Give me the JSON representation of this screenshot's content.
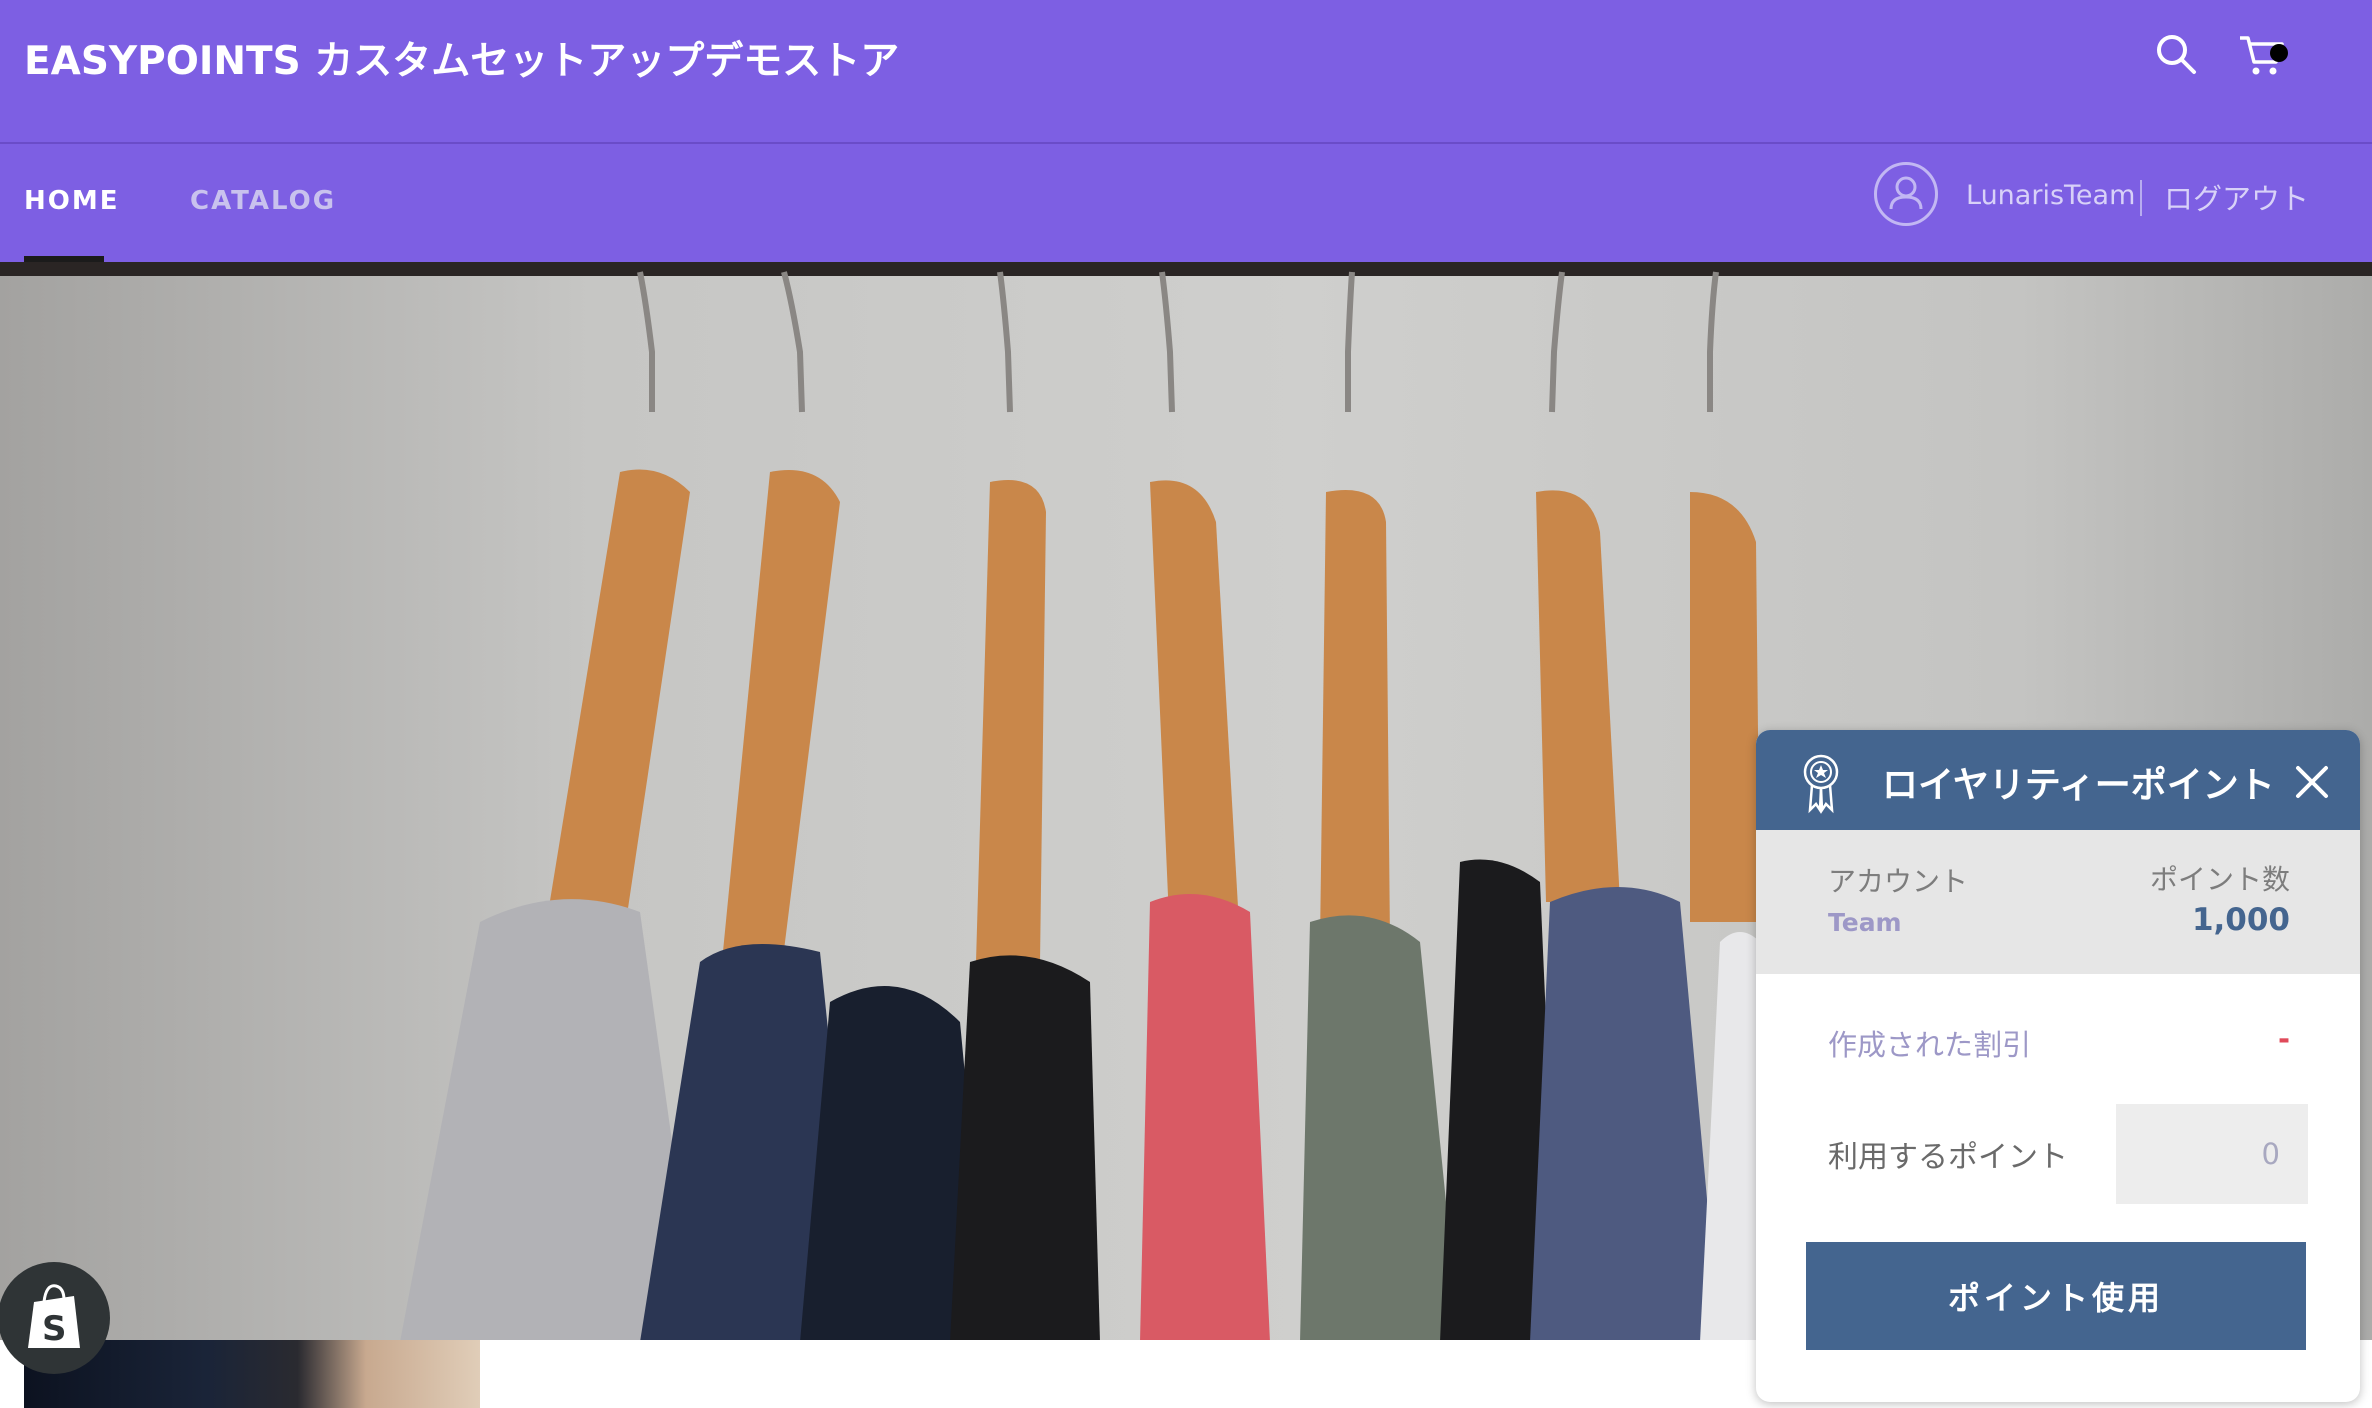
{
  "header": {
    "store_title": "EASYPOINTS カスタムセットアップデモストア",
    "search_icon": "search-icon",
    "cart_icon": "cart-icon"
  },
  "nav": {
    "items": [
      {
        "label": "HOME",
        "active": true
      },
      {
        "label": "CATALOG",
        "active": false
      }
    ],
    "account_name": "LunarisTeam",
    "logout_label": "ログアウト"
  },
  "hero": {
    "description_icon": "clothes-hanger-photo"
  },
  "loyalty_widget": {
    "title": "ロイヤリティーポイント",
    "account_label": "アカウント",
    "account_user": "Team",
    "points_label": "ポイント数",
    "points_value": "1,000",
    "discount_label": "作成された割引",
    "discount_value": "-",
    "use_points_label": "利用するポイント",
    "use_points_placeholder": "0",
    "submit_label": "ポイント使用",
    "colors": {
      "header": "#44658f",
      "accent": "#9d98c7",
      "discount": "#e04a5a"
    }
  },
  "colors": {
    "brand": "#7d5fe3"
  }
}
